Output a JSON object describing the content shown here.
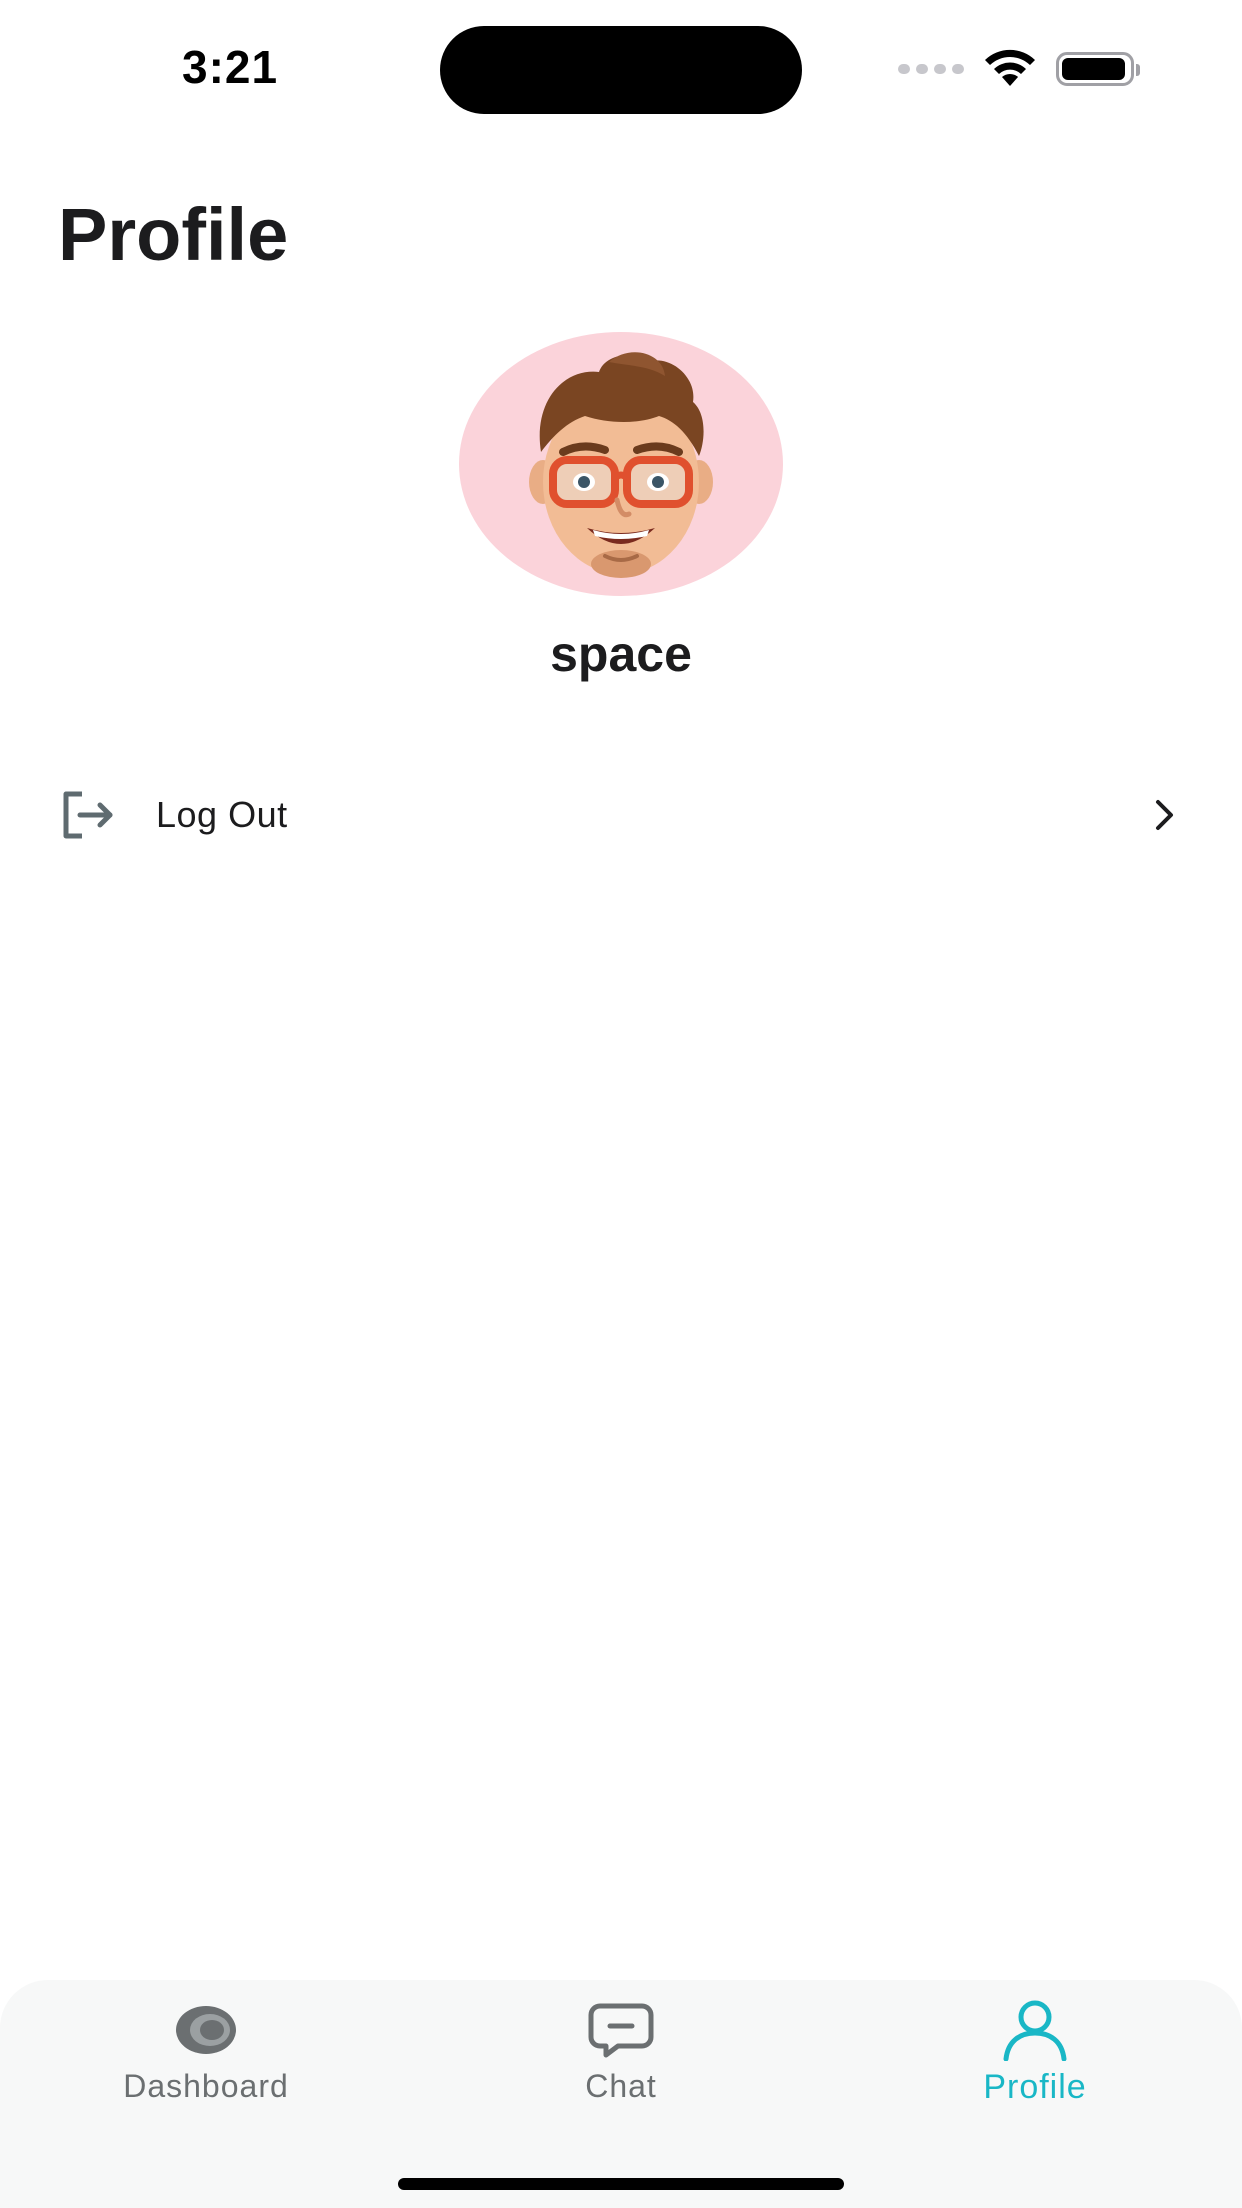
{
  "status_bar": {
    "time": "3:21",
    "battery_level": 0.95
  },
  "page": {
    "title": "Profile"
  },
  "profile": {
    "avatar_icon": "memoji-avatar",
    "username": "space"
  },
  "menu": {
    "items": [
      {
        "label": "Log Out",
        "icon": "logout-icon",
        "trailing_icon": "chevron-right-icon"
      }
    ]
  },
  "tab_bar": {
    "tabs": [
      {
        "label": "Dashboard",
        "icon": "dashboard-icon",
        "active": false
      },
      {
        "label": "Chat",
        "icon": "chat-icon",
        "active": false
      },
      {
        "label": "Profile",
        "icon": "person-icon",
        "active": true
      }
    ],
    "active_color": "#19b7c6",
    "inactive_color": "#6b6f71"
  },
  "colors": {
    "avatar_background": "#fbd3da",
    "tab_bar_background": "#f7f8f8"
  }
}
